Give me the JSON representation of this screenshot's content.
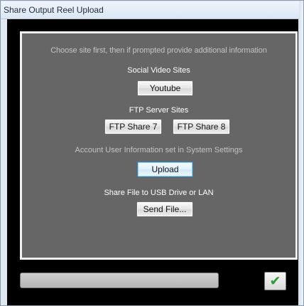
{
  "window": {
    "title": "Share Output Reel Upload"
  },
  "panel": {
    "instruction": "Choose site first, then if prompted provide additional information",
    "social_video_sites_label": "Social Video Sites",
    "youtube_button": "Youtube",
    "ftp_server_sites_label": "FTP Server Sites",
    "ftp_share_7_button": "FTP Share 7",
    "ftp_share_8_button": "FTP Share 8",
    "account_info_label": "Account User Information set in System Settings",
    "upload_button": "Upload",
    "share_file_label": "Share File to USB Drive or LAN",
    "send_file_button": "Send File..."
  },
  "footer": {
    "progress": 0,
    "ok_icon": "check-icon",
    "ok_glyph": "✔"
  },
  "colors": {
    "panel_background": "#666666",
    "client_background": "#000000",
    "panel_border": "#f0f0f0",
    "check_green": "#2c9a35",
    "focus_blue": "#3c7fb1"
  }
}
